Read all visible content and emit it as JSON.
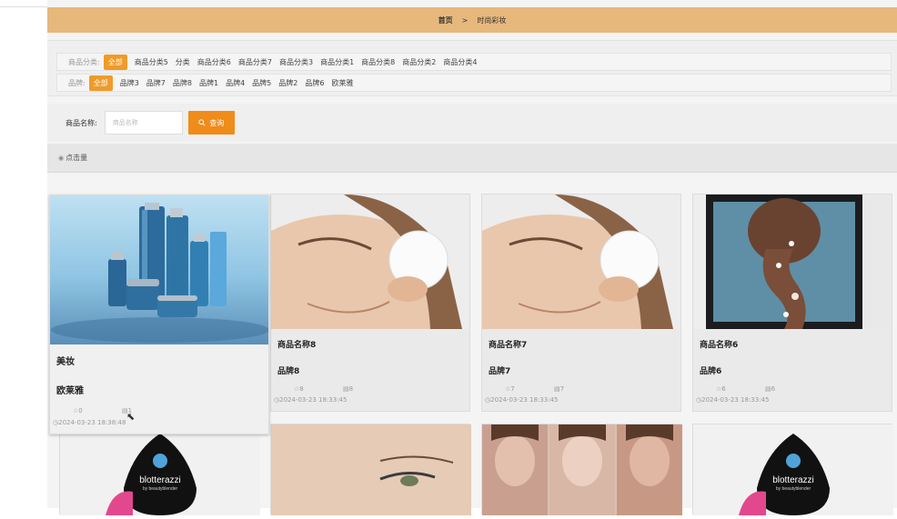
{
  "breadcrumb": {
    "home": "首页",
    "separator": ">",
    "current": "时尚彩妆"
  },
  "filters": {
    "category_label": "商品分类:",
    "categories": [
      "全部",
      "商品分类5",
      "分类",
      "商品分类6",
      "商品分类7",
      "商品分类3",
      "商品分类1",
      "商品分类8",
      "商品分类2",
      "商品分类4"
    ],
    "brand_label": "品牌:",
    "brands": [
      "全部",
      "品牌3",
      "品牌7",
      "品牌8",
      "品牌1",
      "品牌4",
      "品牌5",
      "品牌2",
      "品牌6",
      "欧莱雅"
    ]
  },
  "search": {
    "label": "商品名称:",
    "placeholder": "商品名称",
    "button": "查询",
    "button_icon": "search-icon"
  },
  "sort": {
    "label": "点击量",
    "icon": "eye-icon"
  },
  "products": [
    {
      "name": "美妆",
      "brand": "欧莱雅",
      "favorites": "0",
      "clicks": "1",
      "time": "2024-03-23 18:38:48",
      "image": "cosmetics-bottles"
    },
    {
      "name": "商品名称8",
      "brand": "品牌8",
      "favorites": "8",
      "clicks": "8",
      "time": "2024-03-23 18:33:45",
      "image": "woman-cotton-pad"
    },
    {
      "name": "商品名称7",
      "brand": "品牌7",
      "favorites": "7",
      "clicks": "7",
      "time": "2024-03-23 18:33:45",
      "image": "woman-cotton-pad"
    },
    {
      "name": "商品名称6",
      "brand": "品牌6",
      "favorites": "6",
      "clicks": "6",
      "time": "2024-03-23 18:33:45",
      "image": "braided-hair"
    }
  ],
  "second_row_images": [
    "blotterazzi-sponge",
    "woman-brush",
    "contour-faces",
    "blotterazzi-sponge"
  ],
  "brand_text": {
    "blotterazzi": "blotterazzi",
    "blotterazzi_sub": "by beautyblender"
  }
}
